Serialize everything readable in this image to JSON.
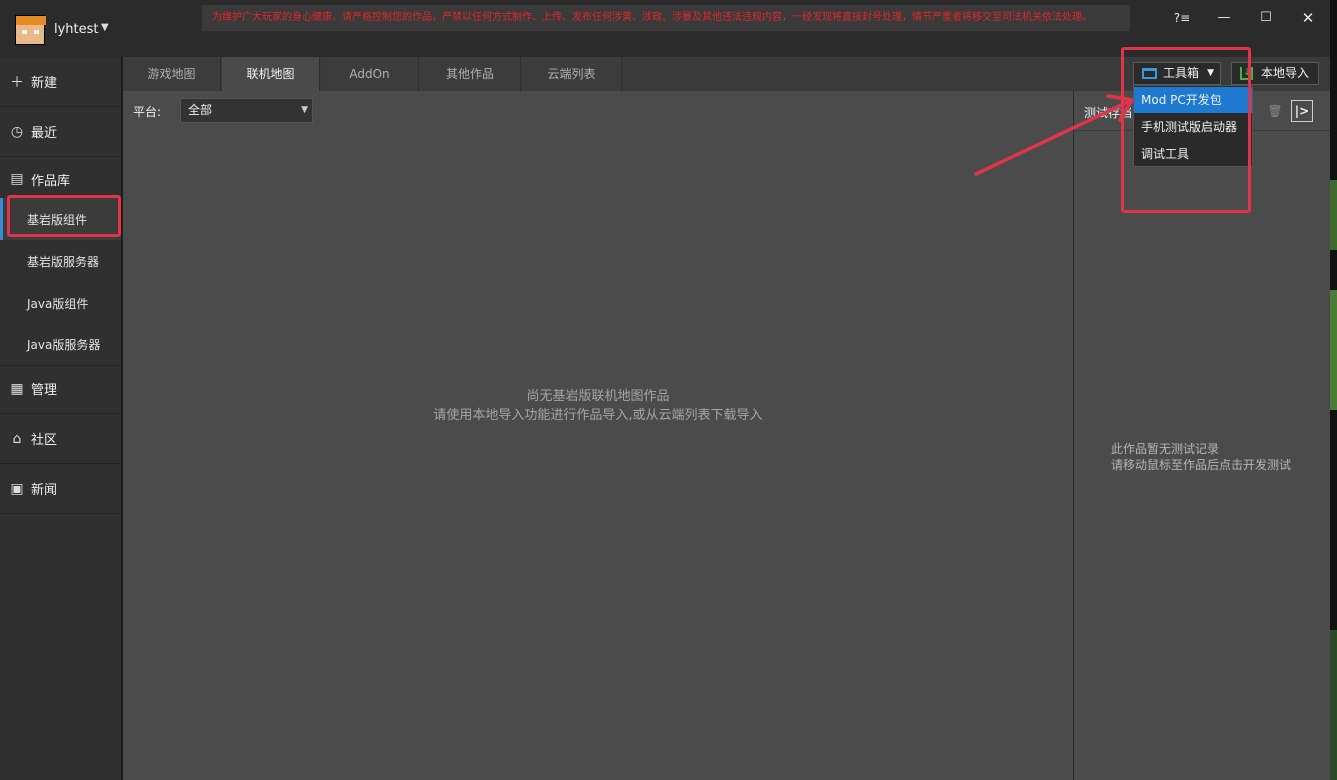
{
  "titlebar": {
    "username": "lyhtest",
    "notice": "为维护广大玩家的身心健康，请严格控制您的作品，严禁以任何方式制作、上传、发布任何涉黄、涉政、涉暴及其他违法违规内容，一经发现将直接封号处理，情节严重者将移交至司法机关依法处理。",
    "help_label": "?≡",
    "min_label": "—",
    "max_label": "☐",
    "close_label": "✕"
  },
  "sidebar": {
    "new_label": "新建",
    "recent_label": "最近",
    "library_label": "作品库",
    "library_items": [
      "基岩版组件",
      "基岩版服务器",
      "Java版组件",
      "Java版服务器"
    ],
    "manage_label": "管理",
    "community_label": "社区",
    "news_label": "新闻"
  },
  "tabs": [
    "游戏地图",
    "联机地图",
    "AddOn",
    "其他作品",
    "云端列表"
  ],
  "active_tab": "联机地图",
  "toolbar": {
    "toolbox_label": "工具箱",
    "import_label": "本地导入"
  },
  "dropdown": {
    "items": [
      "Mod PC开发包",
      "手机测试版启动器",
      "调试工具"
    ],
    "selected": "Mod PC开发包"
  },
  "filter": {
    "platform_label": "平台:",
    "platform_value": "全部"
  },
  "empty_state": {
    "line1": "尚无基岩版联机地图作品",
    "line2": "请使用本地导入功能进行作品导入,或从云端列表下载导入"
  },
  "test_panel": {
    "title": "测试存档",
    "empty_line1": "此作品暂无测试记录",
    "empty_line2": "请移动鼠标至作品后点击开发测试"
  },
  "colors": {
    "accent_blue": "#1e7ad1",
    "annotation_red": "#e0344a",
    "notice_red": "#e0282c"
  }
}
